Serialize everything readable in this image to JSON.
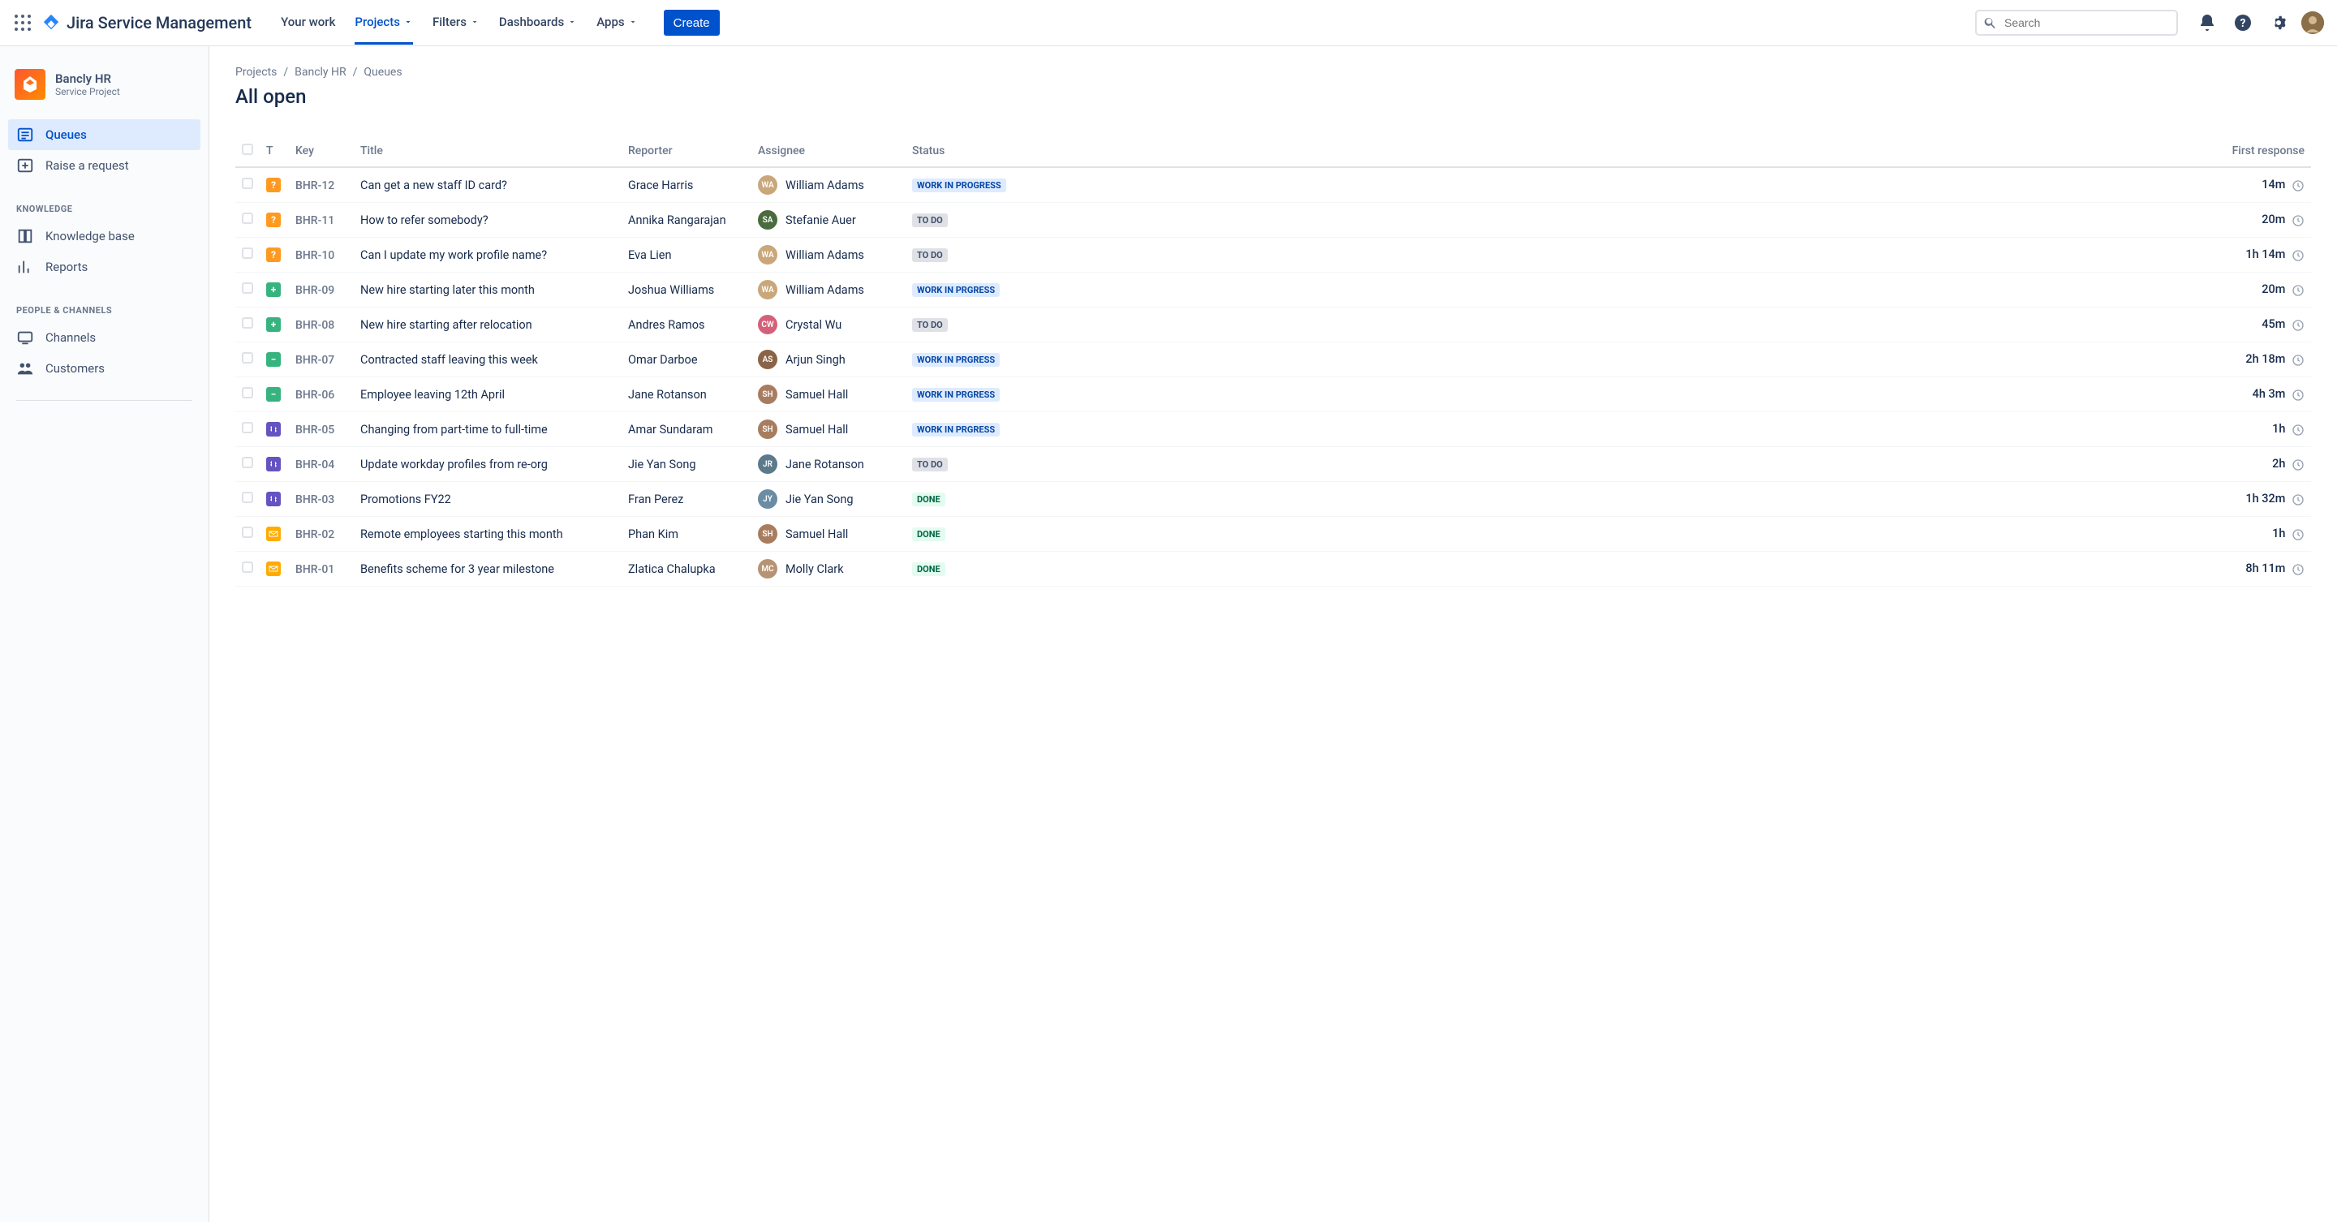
{
  "header": {
    "product_name": "Jira Service Management",
    "nav": {
      "your_work": "Your work",
      "projects": "Projects",
      "filters": "Filters",
      "dashboards": "Dashboards",
      "apps": "Apps"
    },
    "create_label": "Create",
    "search_placeholder": "Search"
  },
  "sidebar": {
    "project_name": "Bancly HR",
    "project_type": "Service Project",
    "items": {
      "queues": "Queues",
      "raise_request": "Raise a request"
    },
    "sections": {
      "knowledge_heading": "KNOWLEDGE",
      "knowledge_base": "Knowledge base",
      "reports": "Reports",
      "people_heading": "PEOPLE & CHANNELS",
      "channels": "Channels",
      "customers": "Customers"
    }
  },
  "breadcrumb": {
    "projects": "Projects",
    "project": "Bancly HR",
    "queues": "Queues"
  },
  "page_title": "All open",
  "table": {
    "headers": {
      "type": "T",
      "key": "Key",
      "title": "Title",
      "reporter": "Reporter",
      "assignee": "Assignee",
      "status": "Status",
      "first_response": "First response"
    },
    "rows": [
      {
        "type": "question",
        "key": "BHR-12",
        "title": "Can get a new staff ID card?",
        "reporter": "Grace Harris",
        "assignee": "William Adams",
        "assignee_color": "#c9a77a",
        "status": "WORK IN PROGRESS",
        "status_class": "inprogress",
        "response": "14m"
      },
      {
        "type": "question",
        "key": "BHR-11",
        "title": "How to refer somebody?",
        "reporter": "Annika Rangarajan",
        "assignee": "Stefanie Auer",
        "assignee_color": "#4a6b3d",
        "status": "TO DO",
        "status_class": "todo",
        "response": "20m"
      },
      {
        "type": "question",
        "key": "BHR-10",
        "title": "Can I update my work profile name?",
        "reporter": "Eva Lien",
        "assignee": "William Adams",
        "assignee_color": "#c9a77a",
        "status": "TO DO",
        "status_class": "todo",
        "response": "1h 14m"
      },
      {
        "type": "add",
        "key": "BHR-09",
        "title": "New hire starting later this month",
        "reporter": "Joshua Williams",
        "assignee": "William Adams",
        "assignee_color": "#c9a77a",
        "status": "WORK IN PRGRESS",
        "status_class": "inprogress",
        "response": "20m"
      },
      {
        "type": "add",
        "key": "BHR-08",
        "title": "New hire starting after relocation",
        "reporter": "Andres Ramos",
        "assignee": "Crystal Wu",
        "assignee_color": "#d4607a",
        "status": "TO DO",
        "status_class": "todo",
        "response": "45m"
      },
      {
        "type": "remove",
        "key": "BHR-07",
        "title": "Contracted staff leaving this week",
        "reporter": "Omar Darboe",
        "assignee": "Arjun Singh",
        "assignee_color": "#8b6346",
        "status": "WORK IN PRGRESS",
        "status_class": "inprogress",
        "response": "2h 18m"
      },
      {
        "type": "remove",
        "key": "BHR-06",
        "title": "Employee leaving 12th April",
        "reporter": "Jane Rotanson",
        "assignee": "Samuel Hall",
        "assignee_color": "#a87c5f",
        "status": "WORK IN PRGRESS",
        "status_class": "inprogress",
        "response": "4h 3m"
      },
      {
        "type": "change",
        "key": "BHR-05",
        "title": "Changing from part-time to full-time",
        "reporter": "Amar Sundaram",
        "assignee": "Samuel Hall",
        "assignee_color": "#a87c5f",
        "status": "WORK IN PRGRESS",
        "status_class": "inprogress",
        "response": "1h"
      },
      {
        "type": "change",
        "key": "BHR-04",
        "title": "Update workday profiles from re-org",
        "reporter": "Jie Yan Song",
        "assignee": "Jane Rotanson",
        "assignee_color": "#5c7a8b",
        "status": "TO DO",
        "status_class": "todo",
        "response": "2h"
      },
      {
        "type": "change",
        "key": "BHR-03",
        "title": "Promotions FY22",
        "reporter": "Fran Perez",
        "assignee": "Jie Yan Song",
        "assignee_color": "#6b8ca3",
        "status": "DONE",
        "status_class": "done",
        "response": "1h 32m"
      },
      {
        "type": "email",
        "key": "BHR-02",
        "title": "Remote employees starting this month",
        "reporter": "Phan Kim",
        "assignee": "Samuel Hall",
        "assignee_color": "#a87c5f",
        "status": "DONE",
        "status_class": "done",
        "response": "1h"
      },
      {
        "type": "email",
        "key": "BHR-01",
        "title": "Benefits scheme for 3 year milestone",
        "reporter": "Zlatica Chalupka",
        "assignee": "Molly Clark",
        "assignee_color": "#b89373",
        "status": "DONE",
        "status_class": "done",
        "response": "8h 11m"
      }
    ]
  }
}
